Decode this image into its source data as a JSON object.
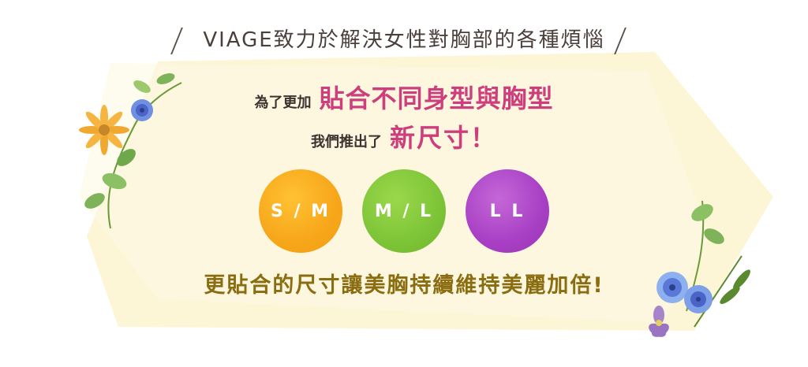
{
  "headline": "VIAGE致力於解決女性對胸部的各種煩惱",
  "line1": {
    "prefix": "為了更加",
    "highlight": "貼合不同身型與胸型"
  },
  "line2": {
    "prefix": "我們推出了",
    "highlight": "新尺寸！"
  },
  "sizes": [
    {
      "label": "S / M",
      "color": "#f7a61a"
    },
    {
      "label": "M / L",
      "color": "#7ec438"
    },
    {
      "label": "L L",
      "color": "#a83fc4"
    }
  ],
  "footer": "更貼合的尺寸讓美胸持續維持美麗加倍!",
  "colors": {
    "accent": "#cc3f7c",
    "footer_text": "#8a6d10",
    "panel": "#fdf6d6"
  },
  "decorations": {
    "left": "flower-vine-left-icon",
    "right": "flower-bouquet-right-icon"
  }
}
